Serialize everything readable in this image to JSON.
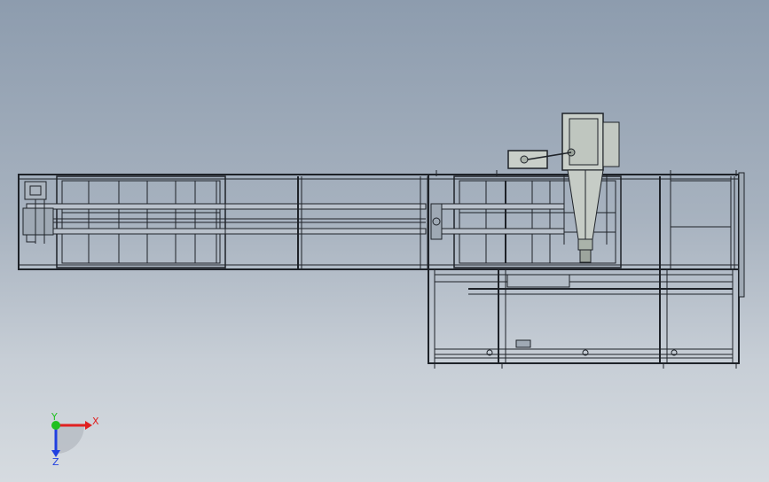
{
  "viewport": {
    "background_top": "#8d9cae",
    "background_bottom": "#d6dbe0",
    "line_color": "#1e2228"
  },
  "triad": {
    "x_label": "X",
    "y_label": "Y",
    "z_label": "Z",
    "x_color": "#e02020",
    "y_color": "#20c020",
    "z_color": "#2040e0"
  }
}
